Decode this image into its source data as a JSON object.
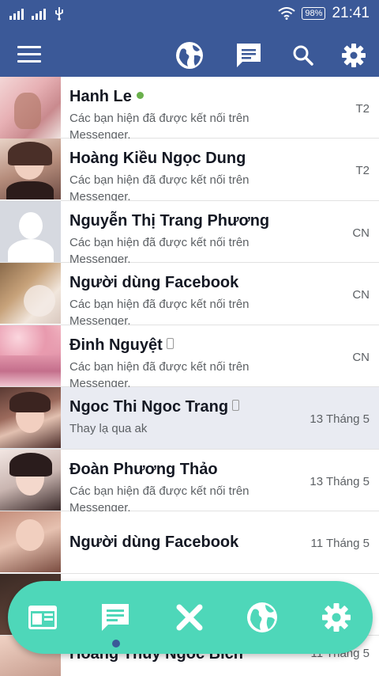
{
  "status": {
    "battery": "98%",
    "time": "21:41"
  },
  "conversations": [
    {
      "name": "Hanh Le",
      "preview": "Các bạn hiện đã được kết nối trên Messenger.",
      "time": "T2"
    },
    {
      "name": "Hoàng Kiều Ngọc Dung",
      "preview": "Các bạn hiện đã được kết nối trên Messenger.",
      "time": "T2"
    },
    {
      "name": "Nguyễn Thị Trang Phương",
      "preview": "Các bạn hiện đã được kết nối trên Messenger.",
      "time": "CN"
    },
    {
      "name": "Người dùng Facebook",
      "preview": "Các bạn hiện đã được kết nối trên Messenger.",
      "time": "CN"
    },
    {
      "name": "Đinh Nguyệt",
      "preview": "Các bạn hiện đã được kết nối trên Messenger.",
      "time": "CN"
    },
    {
      "name": "Ngoc Thi Ngoc Trang",
      "preview": "Thay lạ qua ak",
      "time": "13 Tháng 5"
    },
    {
      "name": "Đoàn Phương Thảo",
      "preview": "Các bạn hiện đã được kết nối trên Messenger.",
      "time": "13 Tháng 5"
    },
    {
      "name": "Người dùng Facebook",
      "preview": "",
      "time": "11 Tháng 5"
    },
    {
      "name": "",
      "preview": "",
      "time": ""
    },
    {
      "name": "Hoang Thùy Ngoc Bich",
      "preview": "",
      "time": "11 Tháng 5"
    }
  ],
  "colors": {
    "brand": "#3b5998",
    "dock": "#4ed7b9",
    "online": "#6ab04c"
  },
  "icons": {
    "appbar": [
      "menu-icon",
      "globe-icon",
      "chat-icon",
      "search-icon",
      "gear-icon"
    ],
    "dock": [
      "browser-icon",
      "chat-icon",
      "close-icon",
      "globe-icon",
      "gear-icon"
    ]
  }
}
